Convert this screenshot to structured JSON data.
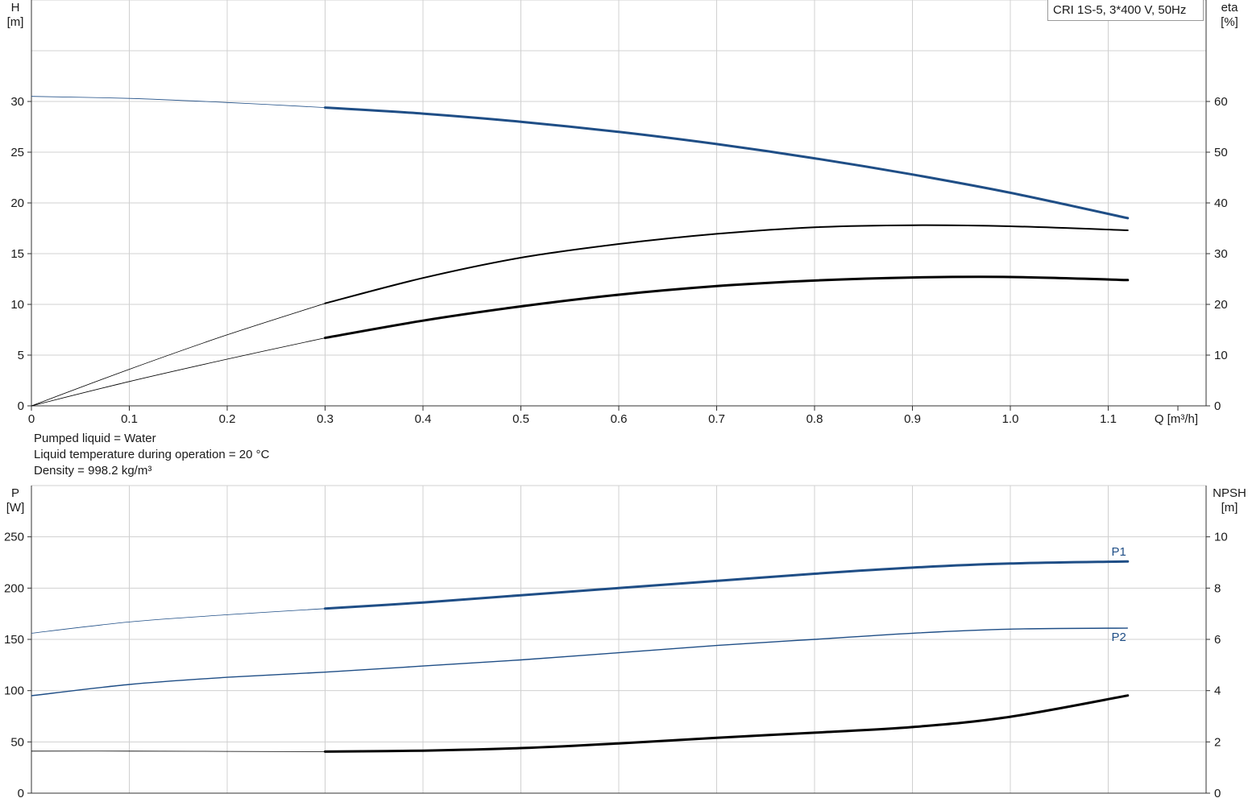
{
  "title_box": "CRI 1S-5, 3*400 V, 50Hz",
  "info": {
    "line1": "Pumped liquid = Water",
    "line2": "Liquid temperature during operation = 20 °C",
    "line3": "Density = 998.2 kg/m³"
  },
  "colors": {
    "blue": "#1f4e86",
    "black": "#000000",
    "grid": "#d0d0d0"
  },
  "chart_data": [
    {
      "type": "line",
      "x_label": "Q [m³/h]",
      "x_ticks": [
        "0",
        "0.1",
        "0.2",
        "0.3",
        "0.4",
        "0.5",
        "0.6",
        "0.7",
        "0.8",
        "0.9",
        "1.0",
        "1.1"
      ],
      "xlim": [
        0,
        1.2
      ],
      "y_left": {
        "label_top": "H",
        "label_unit": "[m]",
        "ticks": [
          "0",
          "5",
          "10",
          "15",
          "20",
          "25",
          "30"
        ],
        "lim": [
          0,
          40
        ]
      },
      "y_right": {
        "label_top": "eta",
        "label_unit": "[%]",
        "ticks": [
          "0",
          "10",
          "20",
          "30",
          "40",
          "50",
          "60"
        ],
        "lim": [
          0,
          80
        ]
      },
      "series": [
        {
          "axis": "left",
          "color": "blue",
          "weight": "bold",
          "x": [
            0,
            0.1,
            0.2,
            0.3,
            0.4,
            0.5,
            0.6,
            0.7,
            0.8,
            0.9,
            1.0,
            1.12
          ],
          "y": [
            30.5,
            30.3,
            29.9,
            29.4,
            28.8,
            28.0,
            27.0,
            25.8,
            24.4,
            22.8,
            21.0,
            18.5
          ],
          "bold_from": 0.3
        },
        {
          "axis": "right",
          "color": "black",
          "weight": "medium",
          "x": [
            0,
            0.1,
            0.2,
            0.3,
            0.4,
            0.5,
            0.6,
            0.7,
            0.8,
            0.9,
            1.0,
            1.12
          ],
          "y": [
            0,
            7.2,
            14.0,
            20.2,
            25.2,
            29.2,
            31.9,
            33.9,
            35.2,
            35.6,
            35.4,
            34.6
          ],
          "bold_from": 0.3
        },
        {
          "axis": "right",
          "color": "black",
          "weight": "bold",
          "x": [
            0,
            0.1,
            0.2,
            0.3,
            0.4,
            0.5,
            0.6,
            0.7,
            0.8,
            0.9,
            1.0,
            1.12
          ],
          "y": [
            0,
            4.8,
            9.2,
            13.4,
            16.8,
            19.6,
            21.9,
            23.6,
            24.7,
            25.3,
            25.4,
            24.8
          ],
          "bold_from": 0.3
        }
      ]
    },
    {
      "type": "line",
      "x_label": "",
      "xlim": [
        0,
        1.2
      ],
      "y_left": {
        "label_top": "P",
        "label_unit": "[W]",
        "ticks": [
          "0",
          "50",
          "100",
          "150",
          "200",
          "250"
        ],
        "lim": [
          0,
          300
        ]
      },
      "y_right": {
        "label_top": "NPSH",
        "label_unit": "[m]",
        "ticks": [
          "0",
          "2",
          "4",
          "6",
          "8",
          "10"
        ],
        "lim": [
          0,
          12
        ]
      },
      "series": [
        {
          "name": "P1",
          "axis": "left",
          "color": "blue",
          "weight": "bold",
          "x": [
            0,
            0.1,
            0.2,
            0.3,
            0.4,
            0.5,
            0.6,
            0.7,
            0.8,
            0.9,
            1.0,
            1.12
          ],
          "y": [
            156,
            167,
            174,
            180,
            186,
            193,
            200,
            207,
            214,
            220,
            224,
            226
          ],
          "bold_from": 0.3
        },
        {
          "name": "P2",
          "axis": "left",
          "color": "blue",
          "weight": "thin",
          "x": [
            0,
            0.1,
            0.2,
            0.3,
            0.4,
            0.5,
            0.6,
            0.7,
            0.8,
            0.9,
            1.0,
            1.12
          ],
          "y": [
            95,
            106,
            113,
            118,
            124,
            130,
            137,
            144,
            150,
            156,
            160,
            161
          ],
          "bold_from": 2
        },
        {
          "axis": "right",
          "color": "black",
          "weight": "bold",
          "x": [
            0,
            0.1,
            0.2,
            0.3,
            0.4,
            0.5,
            0.6,
            0.7,
            0.8,
            0.9,
            1.0,
            1.12
          ],
          "y": [
            1.64,
            1.64,
            1.63,
            1.62,
            1.66,
            1.76,
            1.94,
            2.16,
            2.36,
            2.58,
            2.98,
            3.81
          ],
          "bold_from": 0.3
        }
      ]
    }
  ]
}
